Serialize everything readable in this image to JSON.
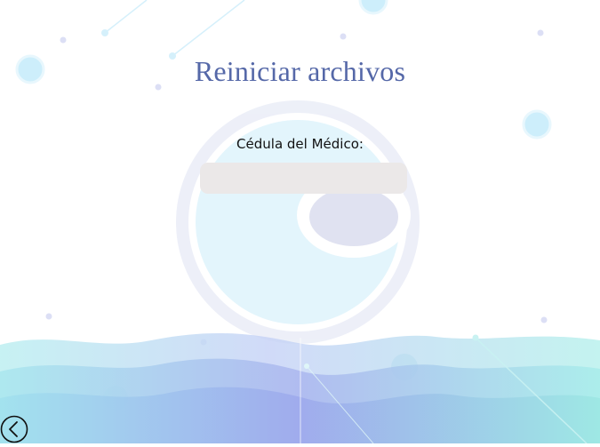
{
  "page": {
    "title": "Reiniciar archivos"
  },
  "form": {
    "cedula_label": "Cédula del Médico:",
    "cedula_value": "",
    "cedula_placeholder": ""
  },
  "navigation": {
    "back_icon": "chevron-left-circle-icon"
  },
  "colors": {
    "title": "#5568a8",
    "input_bg": "#ebe8e8",
    "wave_blue": "#a9b4ee",
    "wave_teal": "#a6ecea",
    "bubble": "#cdeefb"
  }
}
